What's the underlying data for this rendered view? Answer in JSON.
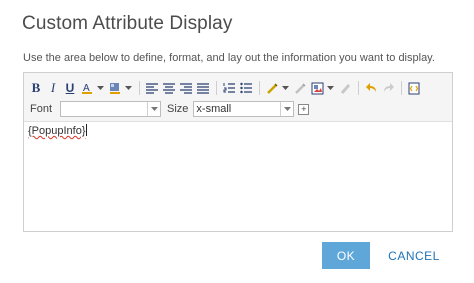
{
  "dialog": {
    "title": "Custom Attribute Display",
    "instructions": "Use the area below to define, format, and lay out the information you want to display."
  },
  "toolbar": {
    "bold_label": "B",
    "italic_label": "I",
    "underline_label": "U",
    "font_label": "Font",
    "font_value": "",
    "size_label": "Size",
    "size_value": "x-small",
    "insert_label": "+"
  },
  "editor": {
    "content": "{PopupInfo}"
  },
  "buttons": {
    "ok": "OK",
    "cancel": "CANCEL"
  },
  "colors": {
    "ok_background": "#5fa7d9",
    "cancel_text": "#1f73b7"
  }
}
